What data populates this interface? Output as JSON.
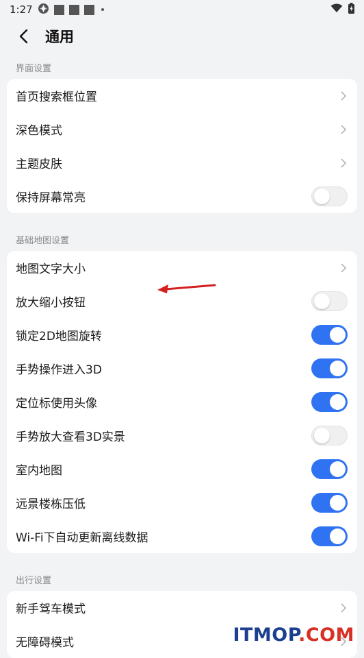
{
  "status_bar": {
    "time": "1:27"
  },
  "header": {
    "title": "通用"
  },
  "sections": [
    {
      "title": "界面设置",
      "items": [
        {
          "label": "首页搜索框位置",
          "control": "chevron"
        },
        {
          "label": "深色模式",
          "control": "chevron"
        },
        {
          "label": "主题皮肤",
          "control": "chevron"
        },
        {
          "label": "保持屏幕常亮",
          "control": "toggle",
          "on": false
        }
      ]
    },
    {
      "title": "基础地图设置",
      "items": [
        {
          "label": "地图文字大小",
          "control": "chevron"
        },
        {
          "label": "放大缩小按钮",
          "control": "toggle",
          "on": false
        },
        {
          "label": "锁定2D地图旋转",
          "control": "toggle",
          "on": true
        },
        {
          "label": "手势操作进入3D",
          "control": "toggle",
          "on": true
        },
        {
          "label": "定位标使用头像",
          "control": "toggle",
          "on": true
        },
        {
          "label": "手势放大查看3D实景",
          "control": "toggle",
          "on": false
        },
        {
          "label": "室内地图",
          "control": "toggle",
          "on": true
        },
        {
          "label": "远景楼栋压低",
          "control": "toggle",
          "on": true
        },
        {
          "label": "Wi-Fi下自动更新离线数据",
          "control": "toggle",
          "on": true
        }
      ]
    },
    {
      "title": "出行设置",
      "items": [
        {
          "label": "新手驾车模式",
          "control": "chevron"
        },
        {
          "label": "无障碍模式",
          "control": "chevron"
        }
      ]
    }
  ],
  "watermark": {
    "part1": "ITMOP",
    "part2": ".COM"
  },
  "colors": {
    "accent": "#2f73f3",
    "background": "#f2f3f5",
    "toggle_off": "#f0f0f0",
    "annotation_arrow": "#d42020"
  }
}
